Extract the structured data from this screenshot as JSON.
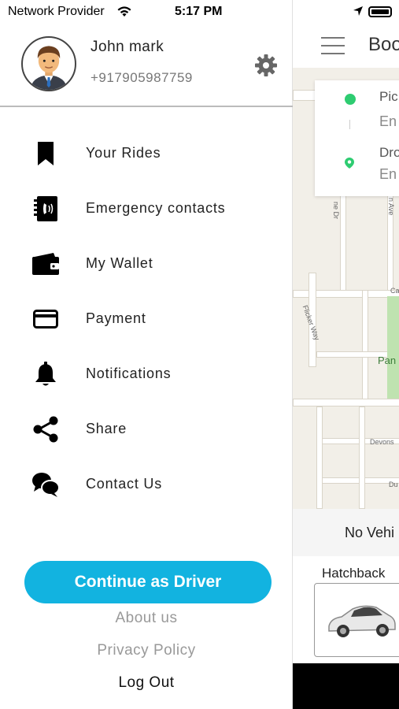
{
  "status_bar": {
    "carrier": "Network Provider",
    "time": "5:17 PM"
  },
  "profile": {
    "name": "John mark",
    "phone": "+917905987759"
  },
  "menu": {
    "items": [
      {
        "label": "Your Rides",
        "icon": "bookmark-icon"
      },
      {
        "label": "Emergency contacts",
        "icon": "phone-book-icon"
      },
      {
        "label": "My Wallet",
        "icon": "wallet-icon"
      },
      {
        "label": "Payment",
        "icon": "credit-card-icon"
      },
      {
        "label": "Notifications",
        "icon": "bell-icon"
      },
      {
        "label": "Share",
        "icon": "share-icon"
      },
      {
        "label": "Contact Us",
        "icon": "chat-bubbles-icon"
      }
    ]
  },
  "actions": {
    "driver_button": "Continue as Driver",
    "about": "About us",
    "privacy": "Privacy Policy",
    "logout": "Log Out"
  },
  "background_app": {
    "title": "Boo",
    "pickup_label": "Pic",
    "pickup_value": "En",
    "drop_label": "Dro",
    "drop_value": "En",
    "map_labels": [
      "ne Dr",
      "n Ave",
      "Ca",
      "Flicker Way",
      "Pan",
      "Devons",
      "Du"
    ],
    "vehicle_status": "No Vehi",
    "vehicle_type": "Hatchback"
  },
  "colors": {
    "accent": "#12b3e0",
    "pickup_green": "#2ecc71",
    "text_muted": "#999999",
    "divider": "#bbbbbb"
  }
}
